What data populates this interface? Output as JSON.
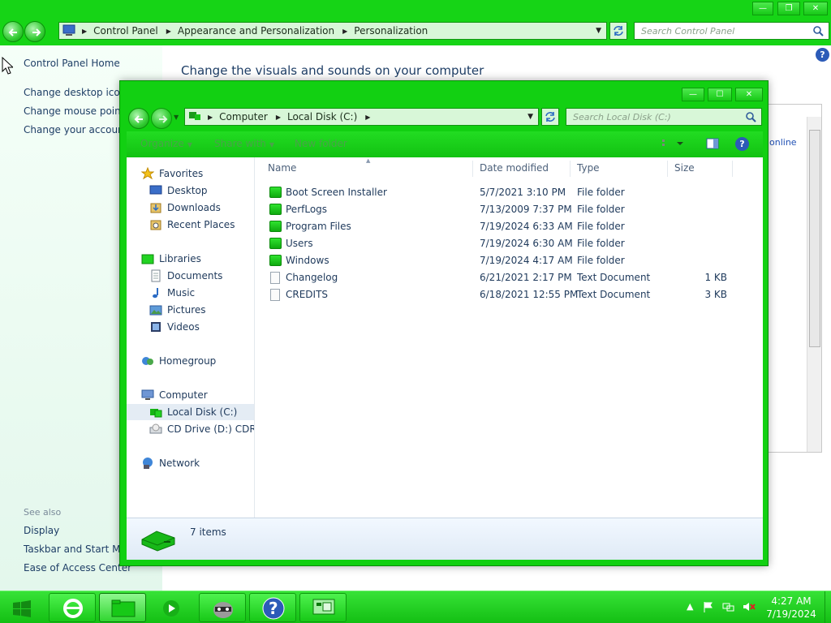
{
  "control_panel": {
    "breadcrumb": [
      "Control Panel",
      "Appearance and Personalization",
      "Personalization"
    ],
    "search_placeholder": "Search Control Panel",
    "left_links": [
      "Control Panel Home",
      "Change desktop icons",
      "Change mouse pointers",
      "Change your account picture"
    ],
    "see_also_label": "See also",
    "see_also_links": [
      "Display",
      "Taskbar and Start Menu",
      "Ease of Access Center"
    ],
    "heading": "Change the visuals and sounds on your computer",
    "help_label": "?",
    "behind_link": "online"
  },
  "explorer": {
    "breadcrumb": [
      "Computer",
      "Local Disk (C:)"
    ],
    "search_placeholder": "Search Local Disk (C:)",
    "toolbar": {
      "organize": "Organize",
      "share_with": "Share with",
      "new_folder": "New folder"
    },
    "nav": {
      "favorites": {
        "label": "Favorites",
        "items": [
          "Desktop",
          "Downloads",
          "Recent Places"
        ]
      },
      "libraries": {
        "label": "Libraries",
        "items": [
          "Documents",
          "Music",
          "Pictures",
          "Videos"
        ]
      },
      "homegroup": "Homegroup",
      "computer": {
        "label": "Computer",
        "items": [
          "Local Disk (C:)",
          "CD Drive (D:) CDROM"
        ]
      },
      "network": "Network"
    },
    "columns": {
      "name": "Name",
      "date": "Date modified",
      "type": "Type",
      "size": "Size"
    },
    "files": [
      {
        "name": "Boot Screen Installer",
        "date": "5/7/2021 3:10 PM",
        "type": "File folder",
        "size": "",
        "kind": "folder"
      },
      {
        "name": "PerfLogs",
        "date": "7/13/2009 7:37 PM",
        "type": "File folder",
        "size": "",
        "kind": "folder"
      },
      {
        "name": "Program Files",
        "date": "7/19/2024 6:33 AM",
        "type": "File folder",
        "size": "",
        "kind": "folder"
      },
      {
        "name": "Users",
        "date": "7/19/2024 6:30 AM",
        "type": "File folder",
        "size": "",
        "kind": "folder"
      },
      {
        "name": "Windows",
        "date": "7/19/2024 4:17 AM",
        "type": "File folder",
        "size": "",
        "kind": "folder"
      },
      {
        "name": "Changelog",
        "date": "6/21/2021 2:17 PM",
        "type": "Text Document",
        "size": "1 KB",
        "kind": "doc"
      },
      {
        "name": "CREDITS",
        "date": "6/18/2021 12:55 PM",
        "type": "Text Document",
        "size": "3 KB",
        "kind": "doc"
      }
    ],
    "status": "7 items"
  },
  "taskbar": {
    "time": "4:27 AM",
    "date": "7/19/2024"
  },
  "theme": {
    "accent": "#16d416",
    "title_text": "#1e395b"
  }
}
